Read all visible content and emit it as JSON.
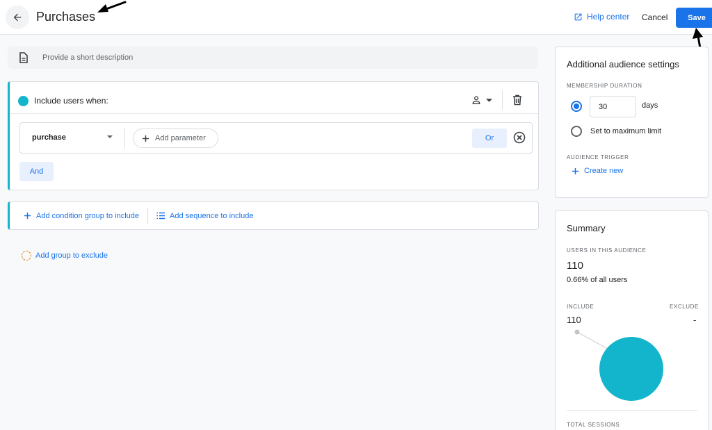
{
  "header": {
    "title": "Purchases",
    "help_label": "Help center",
    "cancel_label": "Cancel",
    "save_label": "Save"
  },
  "description": {
    "placeholder": "Provide a short description"
  },
  "include_group": {
    "title": "Include users when:",
    "event": "purchase",
    "add_parameter_label": "Add parameter",
    "or_label": "Or",
    "and_label": "And"
  },
  "actions": {
    "add_condition_group": "Add condition group to include",
    "add_sequence": "Add sequence to include",
    "add_exclude": "Add group to exclude"
  },
  "settings": {
    "title": "Additional audience settings",
    "membership_label": "MEMBERSHIP DURATION",
    "duration_value": "30",
    "duration_unit": "days",
    "max_limit_label": "Set to maximum limit",
    "trigger_label": "AUDIENCE TRIGGER",
    "create_new_label": "Create new"
  },
  "summary": {
    "title": "Summary",
    "users_label": "USERS IN THIS AUDIENCE",
    "users_value": "110",
    "users_pct": "0.66% of all users",
    "include_label": "INCLUDE",
    "include_value": "110",
    "exclude_label": "EXCLUDE",
    "exclude_value": "-",
    "sessions_label": "TOTAL SESSIONS"
  },
  "colors": {
    "accent": "#1a73e8",
    "include_teal": "#12b5cb",
    "exclude_orange": "#e37400"
  }
}
